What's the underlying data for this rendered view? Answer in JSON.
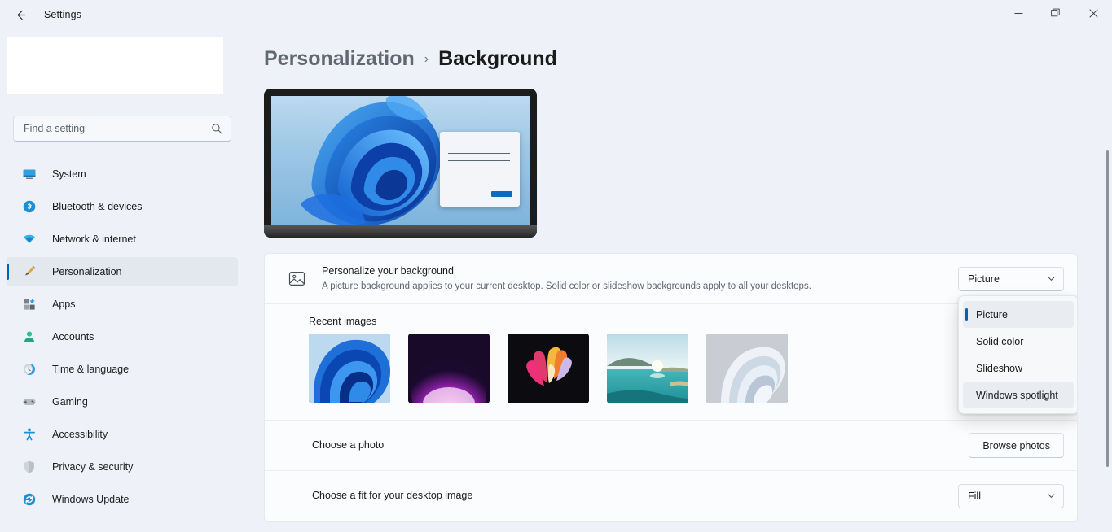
{
  "window": {
    "title": "Settings",
    "back_icon": "arrow-left-icon",
    "minimize_label": "—",
    "maximize_label": "❐",
    "close_label": "✕"
  },
  "sidebar": {
    "search": {
      "placeholder": "Find a setting",
      "value": "",
      "icon": "search-icon"
    },
    "items": [
      {
        "label": "System",
        "icon": "system-icon",
        "active": false
      },
      {
        "label": "Bluetooth & devices",
        "icon": "bluetooth-icon",
        "active": false
      },
      {
        "label": "Network & internet",
        "icon": "network-icon",
        "active": false
      },
      {
        "label": "Personalization",
        "icon": "paintbrush-icon",
        "active": true
      },
      {
        "label": "Apps",
        "icon": "apps-icon",
        "active": false
      },
      {
        "label": "Accounts",
        "icon": "account-icon",
        "active": false
      },
      {
        "label": "Time & language",
        "icon": "clock-icon",
        "active": false
      },
      {
        "label": "Gaming",
        "icon": "gamepad-icon",
        "active": false
      },
      {
        "label": "Accessibility",
        "icon": "accessibility-icon",
        "active": false
      },
      {
        "label": "Privacy & security",
        "icon": "shield-icon",
        "active": false
      },
      {
        "label": "Windows Update",
        "icon": "update-icon",
        "active": false
      }
    ]
  },
  "breadcrumb": {
    "parent": "Personalization",
    "separator": "›",
    "current": "Background"
  },
  "preview": {
    "name": "desktop-background-preview",
    "wallpaper": "windows-11-bloom-blue"
  },
  "settings": {
    "personalize": {
      "icon": "picture-icon",
      "title": "Personalize your background",
      "subtitle": "A picture background applies to your current desktop. Solid color or slideshow backgrounds apply to all your desktops.",
      "selected_value": "Picture",
      "chevron": "chevron-down-icon"
    },
    "recent_images": {
      "label": "Recent images",
      "thumbs": [
        {
          "name": "thumb-bloom-blue",
          "alt": "Blue bloom abstract"
        },
        {
          "name": "thumb-purple-glow",
          "alt": "Purple glowing arc"
        },
        {
          "name": "thumb-flower-dark",
          "alt": "Colorful petals on black"
        },
        {
          "name": "thumb-lake-sunrise",
          "alt": "Lake at sunrise"
        },
        {
          "name": "thumb-white-ribbon",
          "alt": "Pale folded ribbon"
        }
      ]
    },
    "choose_photo": {
      "title": "Choose a photo",
      "button_label": "Browse photos"
    },
    "choose_fit": {
      "title": "Choose a fit for your desktop image",
      "selected_value": "Fill",
      "chevron": "chevron-down-icon"
    }
  },
  "dropdown": {
    "open": true,
    "items": [
      {
        "label": "Picture",
        "selected": true,
        "hovered": false
      },
      {
        "label": "Solid color",
        "selected": false,
        "hovered": false
      },
      {
        "label": "Slideshow",
        "selected": false,
        "hovered": false
      },
      {
        "label": "Windows spotlight",
        "selected": false,
        "hovered": true
      }
    ]
  },
  "colors": {
    "accent": "#0063b1",
    "page_bg": "#eef1f7",
    "card_bg": "#fbfcfd",
    "text": "#1b1b1b",
    "muted": "#5c6470"
  }
}
